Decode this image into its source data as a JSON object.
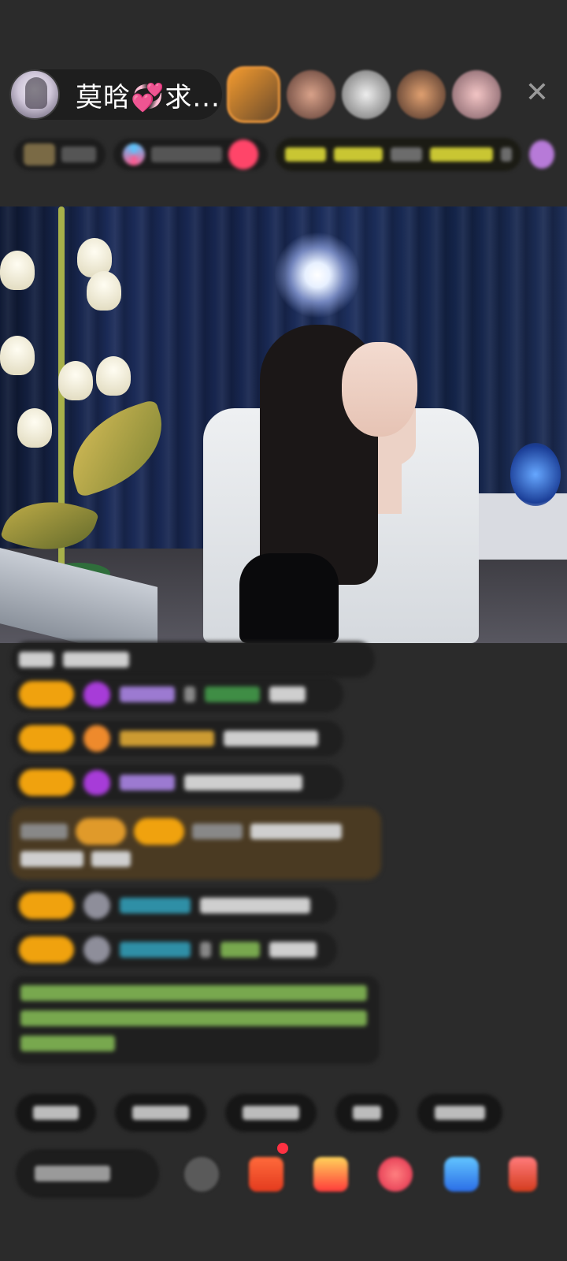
{
  "host": {
    "name": "莫晗💞求..."
  },
  "colors": {
    "background": "#2b2b2b",
    "chat_bubble": "#1f1f1f",
    "level_badge": "#f0a20e",
    "gift_badge_highlight": "#c9c633",
    "notification_dot": "#ff3142"
  },
  "icons": {
    "close": "close-icon",
    "emoji": "emoji-icon",
    "gift": "gift-box-icon",
    "red_packet": "red-packet-icon",
    "fan_club": "fan-club-icon",
    "game": "game-controller-icon",
    "more": "more-apps-icon"
  }
}
